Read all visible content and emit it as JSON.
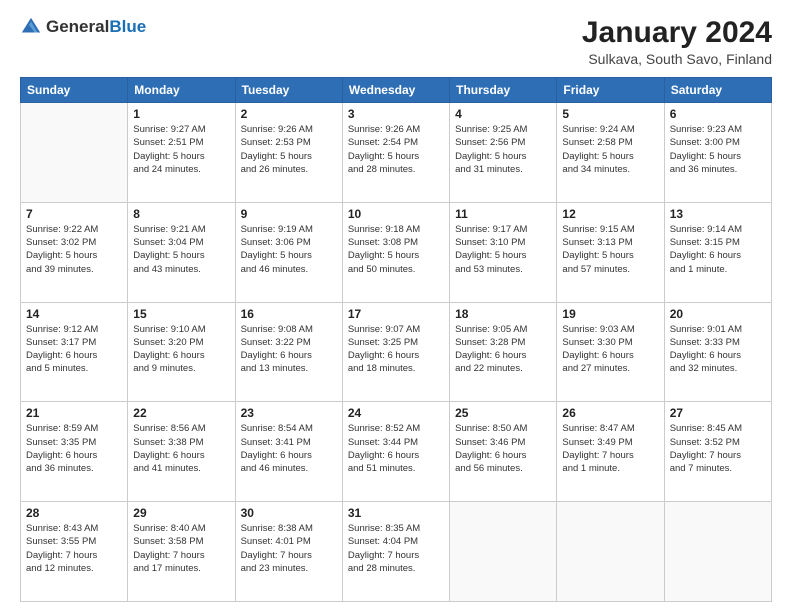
{
  "logo": {
    "general": "General",
    "blue": "Blue"
  },
  "header": {
    "title": "January 2024",
    "subtitle": "Sulkava, South Savo, Finland"
  },
  "weekdays": [
    "Sunday",
    "Monday",
    "Tuesday",
    "Wednesday",
    "Thursday",
    "Friday",
    "Saturday"
  ],
  "weeks": [
    [
      {
        "day": "",
        "info": ""
      },
      {
        "day": "1",
        "info": "Sunrise: 9:27 AM\nSunset: 2:51 PM\nDaylight: 5 hours\nand 24 minutes."
      },
      {
        "day": "2",
        "info": "Sunrise: 9:26 AM\nSunset: 2:53 PM\nDaylight: 5 hours\nand 26 minutes."
      },
      {
        "day": "3",
        "info": "Sunrise: 9:26 AM\nSunset: 2:54 PM\nDaylight: 5 hours\nand 28 minutes."
      },
      {
        "day": "4",
        "info": "Sunrise: 9:25 AM\nSunset: 2:56 PM\nDaylight: 5 hours\nand 31 minutes."
      },
      {
        "day": "5",
        "info": "Sunrise: 9:24 AM\nSunset: 2:58 PM\nDaylight: 5 hours\nand 34 minutes."
      },
      {
        "day": "6",
        "info": "Sunrise: 9:23 AM\nSunset: 3:00 PM\nDaylight: 5 hours\nand 36 minutes."
      }
    ],
    [
      {
        "day": "7",
        "info": "Sunrise: 9:22 AM\nSunset: 3:02 PM\nDaylight: 5 hours\nand 39 minutes."
      },
      {
        "day": "8",
        "info": "Sunrise: 9:21 AM\nSunset: 3:04 PM\nDaylight: 5 hours\nand 43 minutes."
      },
      {
        "day": "9",
        "info": "Sunrise: 9:19 AM\nSunset: 3:06 PM\nDaylight: 5 hours\nand 46 minutes."
      },
      {
        "day": "10",
        "info": "Sunrise: 9:18 AM\nSunset: 3:08 PM\nDaylight: 5 hours\nand 50 minutes."
      },
      {
        "day": "11",
        "info": "Sunrise: 9:17 AM\nSunset: 3:10 PM\nDaylight: 5 hours\nand 53 minutes."
      },
      {
        "day": "12",
        "info": "Sunrise: 9:15 AM\nSunset: 3:13 PM\nDaylight: 5 hours\nand 57 minutes."
      },
      {
        "day": "13",
        "info": "Sunrise: 9:14 AM\nSunset: 3:15 PM\nDaylight: 6 hours\nand 1 minute."
      }
    ],
    [
      {
        "day": "14",
        "info": "Sunrise: 9:12 AM\nSunset: 3:17 PM\nDaylight: 6 hours\nand 5 minutes."
      },
      {
        "day": "15",
        "info": "Sunrise: 9:10 AM\nSunset: 3:20 PM\nDaylight: 6 hours\nand 9 minutes."
      },
      {
        "day": "16",
        "info": "Sunrise: 9:08 AM\nSunset: 3:22 PM\nDaylight: 6 hours\nand 13 minutes."
      },
      {
        "day": "17",
        "info": "Sunrise: 9:07 AM\nSunset: 3:25 PM\nDaylight: 6 hours\nand 18 minutes."
      },
      {
        "day": "18",
        "info": "Sunrise: 9:05 AM\nSunset: 3:28 PM\nDaylight: 6 hours\nand 22 minutes."
      },
      {
        "day": "19",
        "info": "Sunrise: 9:03 AM\nSunset: 3:30 PM\nDaylight: 6 hours\nand 27 minutes."
      },
      {
        "day": "20",
        "info": "Sunrise: 9:01 AM\nSunset: 3:33 PM\nDaylight: 6 hours\nand 32 minutes."
      }
    ],
    [
      {
        "day": "21",
        "info": "Sunrise: 8:59 AM\nSunset: 3:35 PM\nDaylight: 6 hours\nand 36 minutes."
      },
      {
        "day": "22",
        "info": "Sunrise: 8:56 AM\nSunset: 3:38 PM\nDaylight: 6 hours\nand 41 minutes."
      },
      {
        "day": "23",
        "info": "Sunrise: 8:54 AM\nSunset: 3:41 PM\nDaylight: 6 hours\nand 46 minutes."
      },
      {
        "day": "24",
        "info": "Sunrise: 8:52 AM\nSunset: 3:44 PM\nDaylight: 6 hours\nand 51 minutes."
      },
      {
        "day": "25",
        "info": "Sunrise: 8:50 AM\nSunset: 3:46 PM\nDaylight: 6 hours\nand 56 minutes."
      },
      {
        "day": "26",
        "info": "Sunrise: 8:47 AM\nSunset: 3:49 PM\nDaylight: 7 hours\nand 1 minute."
      },
      {
        "day": "27",
        "info": "Sunrise: 8:45 AM\nSunset: 3:52 PM\nDaylight: 7 hours\nand 7 minutes."
      }
    ],
    [
      {
        "day": "28",
        "info": "Sunrise: 8:43 AM\nSunset: 3:55 PM\nDaylight: 7 hours\nand 12 minutes."
      },
      {
        "day": "29",
        "info": "Sunrise: 8:40 AM\nSunset: 3:58 PM\nDaylight: 7 hours\nand 17 minutes."
      },
      {
        "day": "30",
        "info": "Sunrise: 8:38 AM\nSunset: 4:01 PM\nDaylight: 7 hours\nand 23 minutes."
      },
      {
        "day": "31",
        "info": "Sunrise: 8:35 AM\nSunset: 4:04 PM\nDaylight: 7 hours\nand 28 minutes."
      },
      {
        "day": "",
        "info": ""
      },
      {
        "day": "",
        "info": ""
      },
      {
        "day": "",
        "info": ""
      }
    ]
  ]
}
